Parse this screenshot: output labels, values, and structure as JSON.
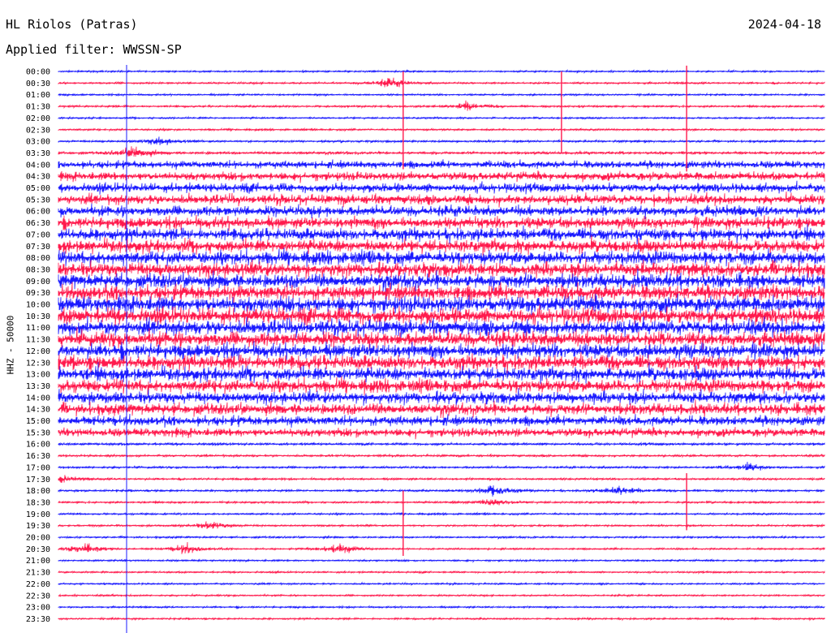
{
  "header": {
    "station": "HL Riolos (Patras)",
    "date": "2024-04-18",
    "filter": "Applied filter: WWSSN-SP"
  },
  "colors": {
    "blue": "#1a1aff",
    "red": "#ff1a4d",
    "background": "#ffffff"
  },
  "chart_data": {
    "type": "line",
    "title": "HL Riolos (Patras)",
    "subtitle": "Applied filter: WWSSN-SP",
    "ylabel": "HHZ - 50000",
    "xlabel": "",
    "trace_colors": [
      "blue",
      "red"
    ],
    "rows": [
      "00:00",
      "00:30",
      "01:00",
      "01:30",
      "02:00",
      "02:30",
      "03:00",
      "03:30",
      "04:00",
      "04:30",
      "05:00",
      "05:30",
      "06:00",
      "06:30",
      "07:00",
      "07:30",
      "08:00",
      "08:30",
      "09:00",
      "09:30",
      "10:00",
      "10:30",
      "11:00",
      "11:30",
      "12:00",
      "12:30",
      "13:00",
      "13:30",
      "14:00",
      "14:30",
      "15:00",
      "15:30",
      "16:00",
      "16:30",
      "17:00",
      "17:30",
      "18:00",
      "18:30",
      "19:00",
      "19:30",
      "20:00",
      "20:30",
      "21:00",
      "21:30",
      "22:00",
      "22:30",
      "23:00",
      "23:30"
    ],
    "noise_level": [
      0.05,
      0.06,
      0.05,
      0.07,
      0.05,
      0.06,
      0.08,
      0.12,
      0.45,
      0.5,
      0.55,
      0.6,
      0.65,
      0.7,
      0.75,
      0.8,
      0.85,
      0.9,
      0.9,
      0.95,
      1.0,
      1.0,
      0.95,
      0.95,
      0.9,
      0.9,
      0.85,
      0.8,
      0.75,
      0.7,
      0.6,
      0.5,
      0.1,
      0.08,
      0.08,
      0.07,
      0.07,
      0.07,
      0.06,
      0.06,
      0.06,
      0.05,
      0.05,
      0.05,
      0.05,
      0.05,
      0.05,
      0.05
    ],
    "events": [
      {
        "row": 1,
        "minute": 13,
        "amplitude": 0.7
      },
      {
        "row": 3,
        "minute": 16,
        "amplitude": 0.5
      },
      {
        "row": 6,
        "minute": 4,
        "amplitude": 0.5
      },
      {
        "row": 7,
        "minute": 3,
        "amplitude": 0.9
      },
      {
        "row": 35,
        "minute": 0,
        "amplitude": 0.6
      },
      {
        "row": 36,
        "minute": 17,
        "amplitude": 0.9
      },
      {
        "row": 36,
        "minute": 22,
        "amplitude": 0.7
      },
      {
        "row": 37,
        "minute": 17,
        "amplitude": 0.6
      },
      {
        "row": 39,
        "minute": 6,
        "amplitude": 0.6
      },
      {
        "row": 41,
        "minute": 1,
        "amplitude": 0.7
      },
      {
        "row": 41,
        "minute": 5,
        "amplitude": 0.7
      },
      {
        "row": 41,
        "minute": 11,
        "amplitude": 0.8
      },
      {
        "row": 34,
        "minute": 27,
        "amplitude": 0.5
      }
    ],
    "spikes": [
      {
        "row": 6,
        "minute": 13.5,
        "height_rows": 6.0
      },
      {
        "row": 5,
        "minute": 19.7,
        "height_rows": 5.0
      },
      {
        "row": 6,
        "minute": 24.6,
        "height_rows": 6.5
      },
      {
        "row": 40,
        "minute": 13.5,
        "height_rows": 4.0
      },
      {
        "row": 38,
        "minute": 24.6,
        "height_rows": 3.5
      }
    ]
  }
}
